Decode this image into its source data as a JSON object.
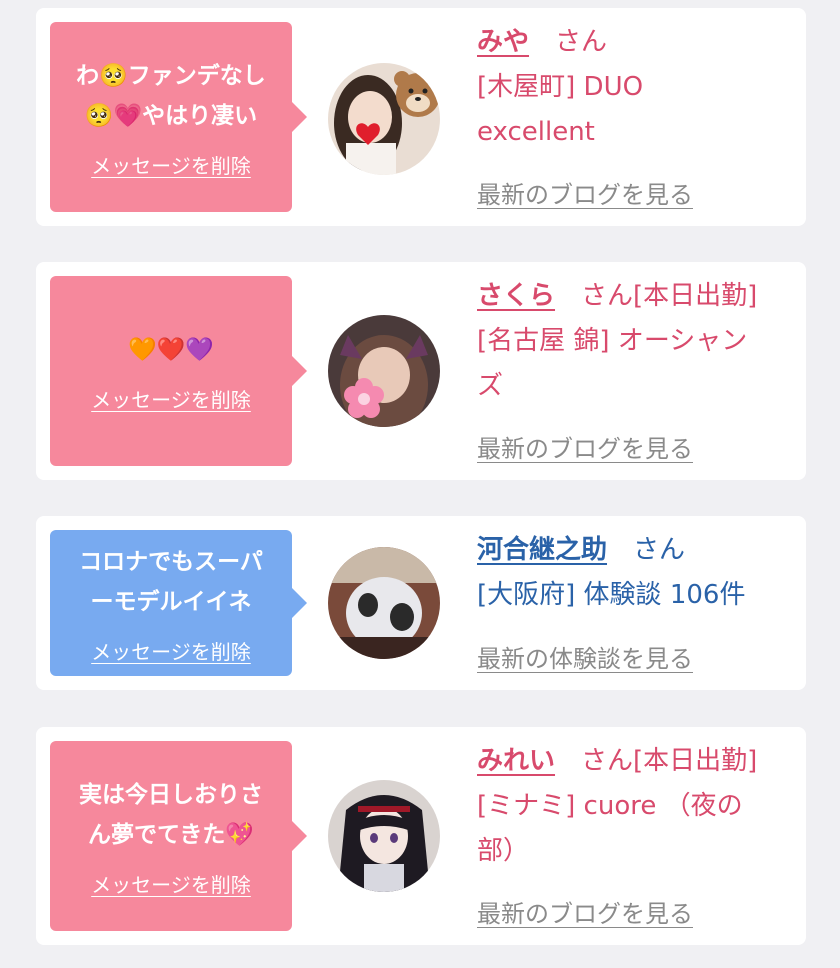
{
  "cards": [
    {
      "message": "わ🥺ファンデなし\n🥺💗やはり凄い",
      "delete_label": "メッセージを削除",
      "name": "みや",
      "honorific": "さん",
      "details": "[木屋町] DUO\nexcellent",
      "blog_link": "最新のブログを見る"
    },
    {
      "message": "🧡❤️💜",
      "delete_label": "メッセージを削除",
      "name": "さくら",
      "honorific": "さん[本日出勤]",
      "details": "[名古屋 錦] オーシャン\nズ",
      "blog_link": "最新のブログを見る"
    },
    {
      "message": "コロナでもスーパ\nーモデルイイネ",
      "delete_label": "メッセージを削除",
      "name": "河合継之助",
      "honorific": "さん",
      "details": "[大阪府] 体験談 106件",
      "blog_link": "最新の体験談を見る"
    },
    {
      "message": "実は今日しおりさ\nん夢でてきた💖",
      "delete_label": "メッセージを削除",
      "name": "みれい",
      "honorific": "さん[本日出勤]",
      "details": "[ミナミ] cuore （夜の\n部）",
      "blog_link": "最新のブログを見る"
    }
  ],
  "colors": {
    "pink_bubble": "#f6889c",
    "blue_bubble": "#78aaf0",
    "pink_text": "#d84a6c",
    "blue_text": "#2a62a8",
    "background": "#f0f0f3"
  }
}
